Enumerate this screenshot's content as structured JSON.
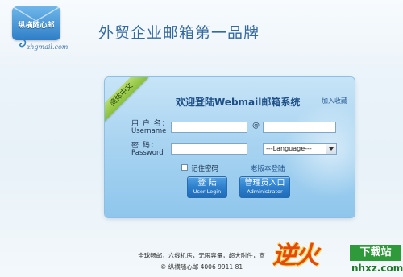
{
  "brand": {
    "logo_text": "纵横随心邮",
    "logo_url": "zhgmail.com",
    "headline": "外贸企业邮箱第一品牌"
  },
  "login_panel": {
    "ribbon": "简体中文",
    "title": "欢迎登陆Webmail邮箱系统",
    "bookmark_link": "加入收藏",
    "username_label_zh": "用 户 名：",
    "username_label_en": "Username",
    "username_value": "",
    "at_sign": "@",
    "domain_value": "",
    "password_label_zh": "密 码：",
    "password_label_en": "Password",
    "password_value": "",
    "language_select": "---Language---",
    "remember_label": "记住密码",
    "old_version_link": "老版本登陆",
    "login_button": {
      "main": "登 陆",
      "sub": "User Login"
    },
    "admin_button": {
      "main": "管理员入口",
      "sub": "Administrator"
    }
  },
  "footer": {
    "line1": "全球畅邮，六线机房，无限容量，超大附件，商",
    "line2": "© 纵横随心邮 4006 9911 81"
  },
  "watermark": {
    "logo": "逆火",
    "tag": "下载站",
    "domain": "nhxz.com"
  },
  "colors": {
    "headline": "#356aa0",
    "panel": "#a9d4f1",
    "button": "#2d7fcd",
    "ribbon": "#89bf3a"
  }
}
